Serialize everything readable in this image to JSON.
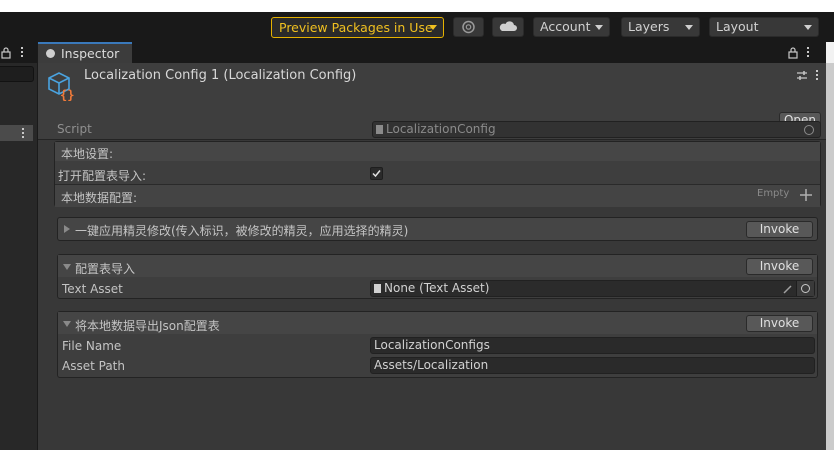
{
  "toolbar": {
    "preview_packages": "Preview Packages in Use",
    "account": "Account",
    "layers": "Layers",
    "layout": "Layout"
  },
  "inspector": {
    "tab_label": "Inspector",
    "title": "Localization Config 1 (Localization Config)",
    "open_label": "Open",
    "script_label": "Script",
    "script_value": "LocalizationConfig",
    "local_settings": "本地设置:",
    "open_import_label": "打开配置表导入:",
    "open_import_checked": true,
    "local_data_label": "本地数据配置:",
    "local_data_empty": "Empty",
    "sections": [
      {
        "title": "一键应用精灵修改(传入标识，被修改的精灵，应用选择的精灵)",
        "expanded": false,
        "invoke": "Invoke"
      },
      {
        "title": "配置表导入",
        "expanded": true,
        "invoke": "Invoke"
      },
      {
        "title": "将本地数据导出Json配置表",
        "expanded": true,
        "invoke": "Invoke"
      }
    ],
    "text_asset_label": "Text Asset",
    "text_asset_value": "None (Text Asset)",
    "file_name_label": "File Name",
    "file_name_value": "LocalizationConfigs",
    "asset_path_label": "Asset Path",
    "asset_path_value": "Assets/Localization"
  },
  "colors": {
    "accent_tab": "#3a79bb",
    "preview_yellow": "#f0c020",
    "icon_blue": "#4aa3df",
    "icon_orange": "#ef7a3a"
  }
}
